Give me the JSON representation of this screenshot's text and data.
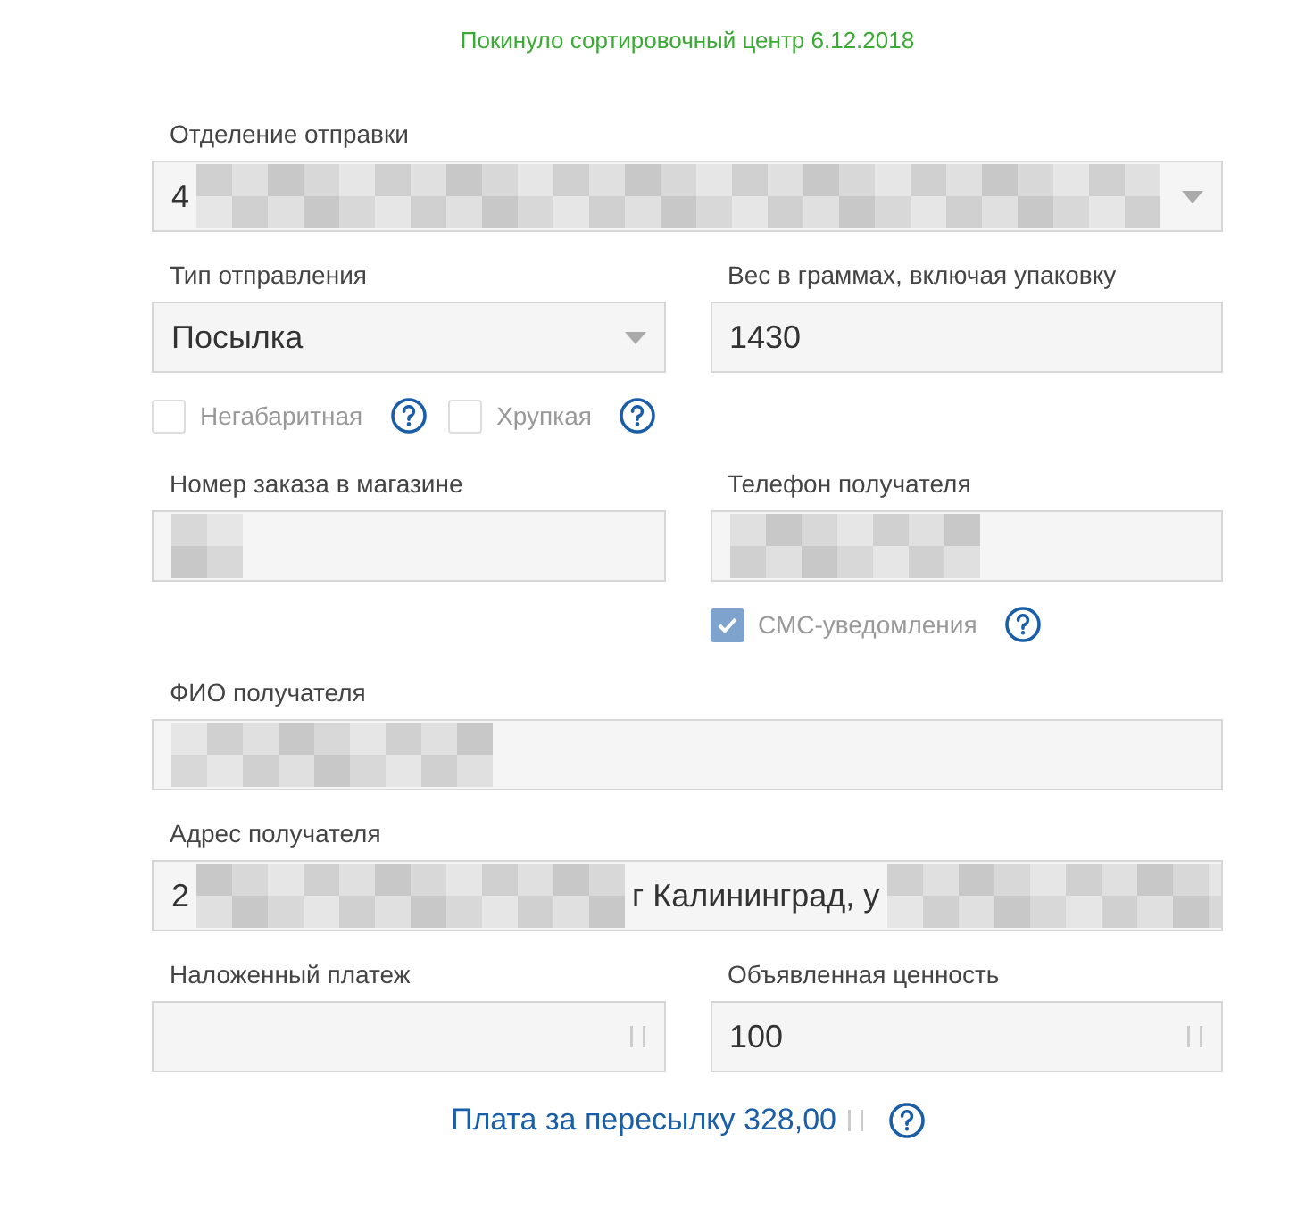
{
  "status": {
    "text": "Покинуло сортировочный центр 6.12.2018"
  },
  "rows": [
    {
      "fields": [
        {
          "label": "Отделение отправки",
          "kind": "select",
          "value": [
            {
              "kind": "text",
              "text": "4"
            },
            {
              "kind": "redacted"
            }
          ]
        }
      ]
    },
    {
      "fields": [
        {
          "label": "Тип отправления",
          "kind": "select",
          "value": [
            {
              "kind": "text",
              "text": "Посылка"
            }
          ],
          "checks": [
            {
              "label": "Негабаритная",
              "checked": false,
              "disabled": true,
              "help": true
            },
            {
              "label": "Хрупкая",
              "checked": false,
              "disabled": true,
              "help": true
            }
          ]
        },
        {
          "label": "Вес в граммах, включая упаковку",
          "kind": "input",
          "value": [
            {
              "kind": "text",
              "text": "1430"
            }
          ]
        }
      ]
    },
    {
      "fields": [
        {
          "label": "Номер заказа в магазине",
          "kind": "input",
          "value": [
            {
              "kind": "redacted"
            }
          ]
        },
        {
          "label": "Телефон получателя",
          "kind": "input",
          "value": [
            {
              "kind": "redacted"
            }
          ],
          "checks": [
            {
              "label": "СМС-уведомления",
              "checked": true,
              "disabled": true,
              "help": true
            }
          ]
        }
      ]
    },
    {
      "fields": [
        {
          "label": "ФИО получателя",
          "kind": "input",
          "value": [
            {
              "kind": "redacted"
            }
          ]
        }
      ]
    },
    {
      "fields": [
        {
          "label": "Адрес получателя",
          "kind": "input",
          "value": [
            {
              "kind": "text",
              "text": "2"
            },
            {
              "kind": "redacted"
            },
            {
              "kind": "text",
              "text": "г Калининград, у"
            },
            {
              "kind": "redacted"
            }
          ]
        }
      ]
    },
    {
      "fields": [
        {
          "label": "Наложенный платеж",
          "kind": "number"
        },
        {
          "label": "Объявленная ценность",
          "kind": "number",
          "value": [
            {
              "kind": "text",
              "text": "100"
            }
          ]
        }
      ]
    }
  ],
  "fee": {
    "text": "Плата за пересылку 328,00",
    "help": true
  }
}
